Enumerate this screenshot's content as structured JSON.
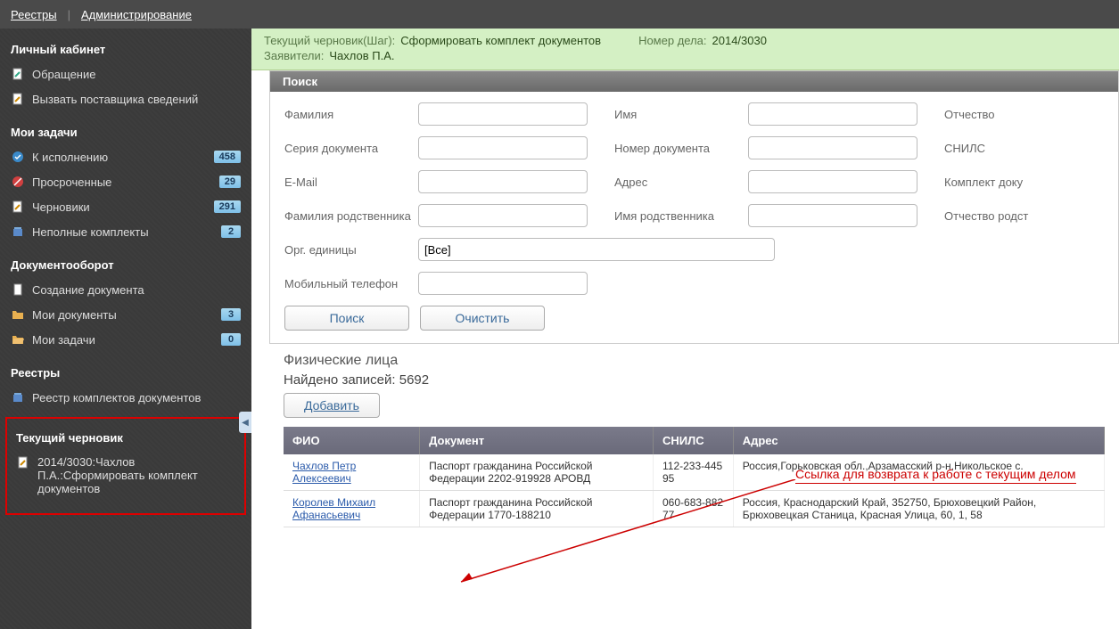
{
  "topnav": {
    "registries": "Реестры",
    "admin": "Администрирование"
  },
  "sidebar": {
    "cabinet_title": "Личный кабинет",
    "cabinet": [
      {
        "label": "Обращение"
      },
      {
        "label": "Вызвать поставщика сведений"
      }
    ],
    "tasks_title": "Мои задачи",
    "tasks": [
      {
        "label": "К исполнению",
        "badge": "458"
      },
      {
        "label": "Просроченные",
        "badge": "29"
      },
      {
        "label": "Черновики",
        "badge": "291"
      },
      {
        "label": "Неполные комплекты",
        "badge": "2"
      }
    ],
    "docflow_title": "Документооборот",
    "docflow": [
      {
        "label": "Создание документа"
      },
      {
        "label": "Мои документы",
        "badge": "3"
      },
      {
        "label": "Мои задачи",
        "badge": "0"
      }
    ],
    "registries_title": "Реестры",
    "registries": [
      {
        "label": "Реестр комплектов документов"
      }
    ],
    "draft_title": "Текущий черновик",
    "draft_item": "2014/3030:Чахлов П.А.:Сформировать комплект документов"
  },
  "infobar": {
    "step_label": "Текущий черновик(Шаг):",
    "step_value": "Сформировать комплект документов",
    "case_label": "Номер дела:",
    "case_value": "2014/3030",
    "appl_label": "Заявители:",
    "appl_value": "Чахлов П.А."
  },
  "search": {
    "title": "Поиск",
    "labels": {
      "lastname": "Фамилия",
      "firstname": "Имя",
      "middlename": "Отчество",
      "doc_series": "Серия документа",
      "doc_number": "Номер документа",
      "snils": "СНИЛС",
      "email": "E-Mail",
      "address": "Адрес",
      "set": "Комплект доку",
      "rel_lastname": "Фамилия родственника",
      "rel_firstname": "Имя родственника",
      "rel_middlename": "Отчество родст",
      "org": "Орг. единицы",
      "phone": "Мобильный телефон"
    },
    "org_value": "[Все]",
    "btn_search": "Поиск",
    "btn_clear": "Очистить"
  },
  "results": {
    "title": "Физические лица",
    "count_label": "Найдено записей:",
    "count": "5692",
    "btn_add": "Добавить",
    "columns": [
      "ФИО",
      "Документ",
      "СНИЛС",
      "Адрес"
    ],
    "rows": [
      {
        "fio": "Чахлов Петр Алексеевич",
        "doc": "Паспорт гражданина Российской Федерации 2202-919928 АРОВД",
        "snils": "112-233-445 95",
        "addr": "Россия,Горьковская обл.,Арзамасский р-н,Никольское с."
      },
      {
        "fio": "Королев Михаил Афанасьевич",
        "doc": "Паспорт гражданина Российской Федерации 1770-188210",
        "snils": "060-683-882 77",
        "addr": "Россия, Краснодарский Край, 352750, Брюховецкий Район, Брюховецкая Станица, Красная Улица, 60, 1, 58"
      }
    ]
  },
  "annotation": "Ссылка для возврата к работе с текущим делом"
}
